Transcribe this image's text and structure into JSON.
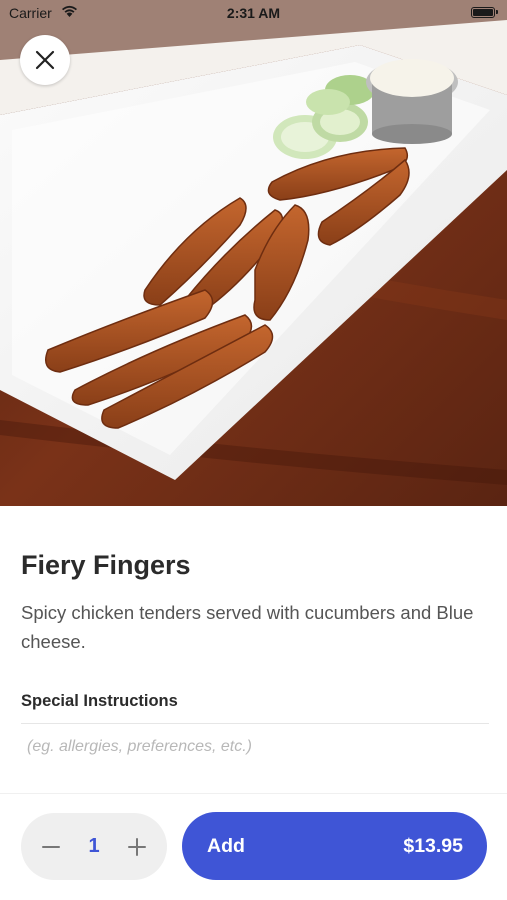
{
  "status_bar": {
    "carrier": "Carrier",
    "time": "2:31 AM"
  },
  "hero": {
    "photo_subject": "chicken tenders with cucumber slices and blue cheese dip on white platter"
  },
  "item": {
    "title": "Fiery Fingers",
    "description": "Spicy chicken tenders served with cucumbers and Blue cheese."
  },
  "instructions": {
    "label": "Special Instructions",
    "placeholder": "(eg. allergies, preferences, etc.)",
    "value": ""
  },
  "order": {
    "quantity": "1",
    "add_label": "Add",
    "price": "$13.95"
  },
  "colors": {
    "accent": "#3f55d6",
    "stepper_bg": "#efefef",
    "title": "#2b2b2b",
    "body_text": "#555555"
  },
  "icons": {
    "close": "close-icon",
    "minus": "minus-icon",
    "plus": "plus-icon",
    "wifi": "wifi-icon",
    "battery": "battery-icon"
  }
}
